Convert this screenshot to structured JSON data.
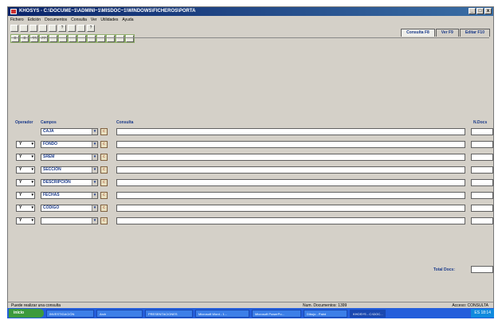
{
  "window": {
    "title": "KHOSYS - C:\\DOCUME~1\\ADMINI~1\\MISDOC~1\\WINDOWS\\FICHEROS\\PORTA",
    "btn_min": "_",
    "btn_max": "□",
    "btn_close": "x"
  },
  "menu": [
    "Fichero",
    "Edición",
    "Documentos",
    "Consulta",
    "Ver",
    "Utilidades",
    "Ayuda"
  ],
  "toolbar1": [
    "",
    "",
    "",
    "",
    "",
    "?",
    "",
    "",
    "?"
  ],
  "toolbar2": [
    "≡",
    "≡",
    "<<",
    ">>",
    "",
    "",
    "",
    "",
    "",
    "",
    "",
    "",
    ""
  ],
  "tabs": [
    "Consulta F8",
    "Ver F9",
    "Editar F10"
  ],
  "headers": {
    "operador": "Operador",
    "campos": "Campos",
    "consulta": "Consulta",
    "ndocs": "N.Docs"
  },
  "rows": [
    {
      "op": "",
      "campo": "CAJA"
    },
    {
      "op": "Y",
      "campo": "FONDO"
    },
    {
      "op": "Y",
      "campo": "SREM"
    },
    {
      "op": "Y",
      "campo": "SECCIÓN"
    },
    {
      "op": "Y",
      "campo": "DESCRIPCIÓN"
    },
    {
      "op": "Y",
      "campo": "FECHAS"
    },
    {
      "op": "Y",
      "campo": "CÓDIGO"
    },
    {
      "op": "Y",
      "campo": ""
    }
  ],
  "camp_btn_label": "c",
  "total": {
    "label": "Total Docs:"
  },
  "status": {
    "left": "Puede realizar una consulta",
    "mid": "Num. Documentos: 1399",
    "right": "Acceso: CONSULTA"
  },
  "taskbar": {
    "start": "inicio",
    "tasks": [
      "INVESTIGACIÓN",
      "Arch",
      "PRESENTACIONES",
      "Microsoft Word - 1...",
      "Microsoft PowerPo...",
      "Dibujo - Paint",
      "KHOSYS - C:\\DOC..."
    ],
    "tray": "ES  18:14"
  },
  "colors": {
    "accent": "#1a3a8a",
    "toolbar": "#8fae6a",
    "taskbar": "#245edb"
  }
}
